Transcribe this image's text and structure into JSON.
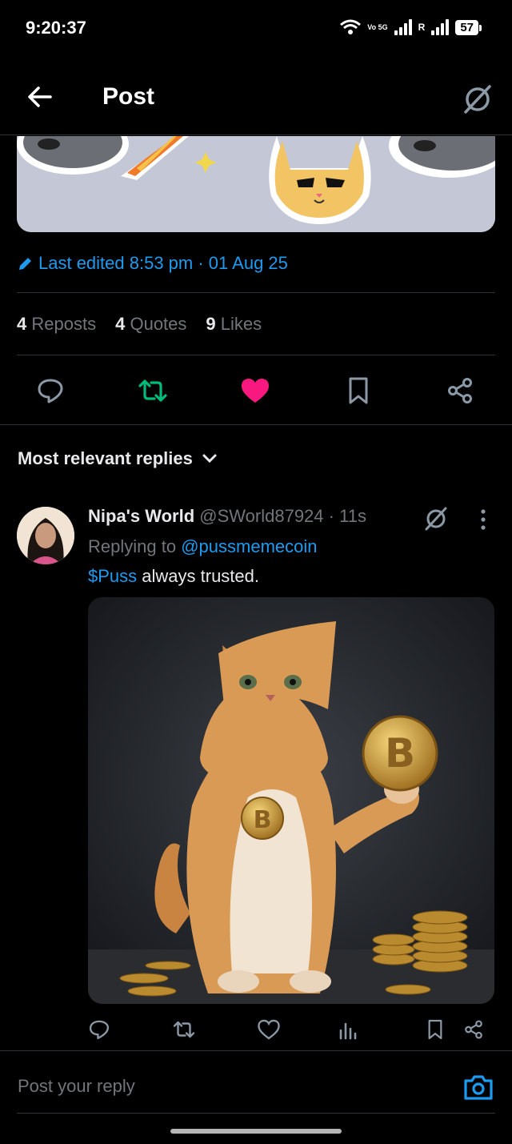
{
  "status_bar": {
    "time": "9:20:37",
    "network": "Vo 5G",
    "roaming": "R",
    "battery": "57"
  },
  "header": {
    "title": "Post"
  },
  "post": {
    "edited": "Last edited 8:53 pm · 01 Aug 25",
    "stats": {
      "reposts_count": "4",
      "reposts_label": "Reposts",
      "quotes_count": "4",
      "quotes_label": "Quotes",
      "likes_count": "9",
      "likes_label": "Likes"
    },
    "liked": true,
    "colors": {
      "repost": "#00ba7c",
      "like": "#f91880",
      "link": "#1d9bf0"
    }
  },
  "replies": {
    "sort_label": "Most relevant replies",
    "items": [
      {
        "name": "Nipa's World",
        "handle": "@SWorld87924",
        "time": "· 11s",
        "replying_prefix": "Replying to",
        "replying_to": "@pussmemecoin",
        "cashtag": "$Puss",
        "text": " always trusted."
      }
    ]
  },
  "composer": {
    "placeholder": "Post your reply"
  }
}
